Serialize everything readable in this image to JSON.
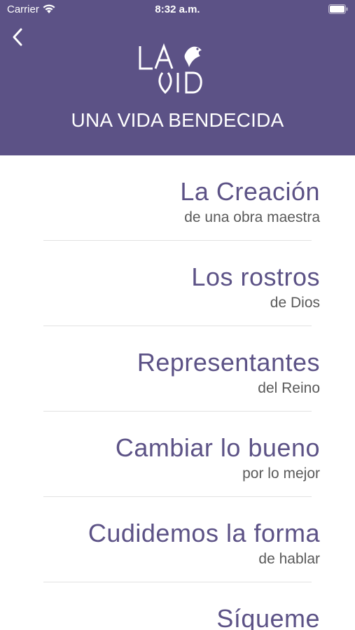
{
  "status_bar": {
    "carrier": "Carrier",
    "time": "8:32 a.m."
  },
  "header": {
    "logo_text": "LA VID",
    "title": "UNA VIDA BENDECIDA",
    "background_color": "#5c5286"
  },
  "icons": {
    "back": "chevron-left",
    "wifi": "wifi",
    "battery": "battery-full"
  },
  "items": [
    {
      "title": "La Creación",
      "subtitle": "de una obra maestra"
    },
    {
      "title": "Los rostros",
      "subtitle": "de Dios"
    },
    {
      "title": "Representantes",
      "subtitle": "del Reino"
    },
    {
      "title": "Cambiar lo bueno",
      "subtitle": "por lo mejor"
    },
    {
      "title": "Cudidemos la forma",
      "subtitle": "de hablar"
    },
    {
      "title": "Síqueme",
      "subtitle": ""
    }
  ],
  "colors": {
    "accent": "#5c5286",
    "subtitle": "#5a5a5a",
    "divider": "#e2e2e2"
  }
}
